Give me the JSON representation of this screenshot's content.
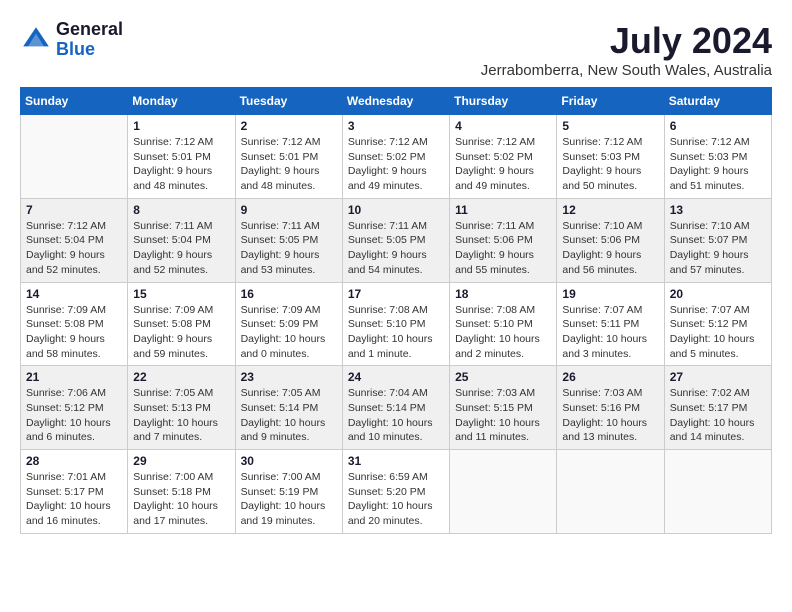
{
  "header": {
    "logo_general": "General",
    "logo_blue": "Blue",
    "title": "July 2024",
    "location": "Jerrabomberra, New South Wales, Australia"
  },
  "weekdays": [
    "Sunday",
    "Monday",
    "Tuesday",
    "Wednesday",
    "Thursday",
    "Friday",
    "Saturday"
  ],
  "weeks": [
    [
      {
        "day": "",
        "info": ""
      },
      {
        "day": "1",
        "info": "Sunrise: 7:12 AM\nSunset: 5:01 PM\nDaylight: 9 hours\nand 48 minutes."
      },
      {
        "day": "2",
        "info": "Sunrise: 7:12 AM\nSunset: 5:01 PM\nDaylight: 9 hours\nand 48 minutes."
      },
      {
        "day": "3",
        "info": "Sunrise: 7:12 AM\nSunset: 5:02 PM\nDaylight: 9 hours\nand 49 minutes."
      },
      {
        "day": "4",
        "info": "Sunrise: 7:12 AM\nSunset: 5:02 PM\nDaylight: 9 hours\nand 49 minutes."
      },
      {
        "day": "5",
        "info": "Sunrise: 7:12 AM\nSunset: 5:03 PM\nDaylight: 9 hours\nand 50 minutes."
      },
      {
        "day": "6",
        "info": "Sunrise: 7:12 AM\nSunset: 5:03 PM\nDaylight: 9 hours\nand 51 minutes."
      }
    ],
    [
      {
        "day": "7",
        "info": "Sunrise: 7:12 AM\nSunset: 5:04 PM\nDaylight: 9 hours\nand 52 minutes."
      },
      {
        "day": "8",
        "info": "Sunrise: 7:11 AM\nSunset: 5:04 PM\nDaylight: 9 hours\nand 52 minutes."
      },
      {
        "day": "9",
        "info": "Sunrise: 7:11 AM\nSunset: 5:05 PM\nDaylight: 9 hours\nand 53 minutes."
      },
      {
        "day": "10",
        "info": "Sunrise: 7:11 AM\nSunset: 5:05 PM\nDaylight: 9 hours\nand 54 minutes."
      },
      {
        "day": "11",
        "info": "Sunrise: 7:11 AM\nSunset: 5:06 PM\nDaylight: 9 hours\nand 55 minutes."
      },
      {
        "day": "12",
        "info": "Sunrise: 7:10 AM\nSunset: 5:06 PM\nDaylight: 9 hours\nand 56 minutes."
      },
      {
        "day": "13",
        "info": "Sunrise: 7:10 AM\nSunset: 5:07 PM\nDaylight: 9 hours\nand 57 minutes."
      }
    ],
    [
      {
        "day": "14",
        "info": "Sunrise: 7:09 AM\nSunset: 5:08 PM\nDaylight: 9 hours\nand 58 minutes."
      },
      {
        "day": "15",
        "info": "Sunrise: 7:09 AM\nSunset: 5:08 PM\nDaylight: 9 hours\nand 59 minutes."
      },
      {
        "day": "16",
        "info": "Sunrise: 7:09 AM\nSunset: 5:09 PM\nDaylight: 10 hours\nand 0 minutes."
      },
      {
        "day": "17",
        "info": "Sunrise: 7:08 AM\nSunset: 5:10 PM\nDaylight: 10 hours\nand 1 minute."
      },
      {
        "day": "18",
        "info": "Sunrise: 7:08 AM\nSunset: 5:10 PM\nDaylight: 10 hours\nand 2 minutes."
      },
      {
        "day": "19",
        "info": "Sunrise: 7:07 AM\nSunset: 5:11 PM\nDaylight: 10 hours\nand 3 minutes."
      },
      {
        "day": "20",
        "info": "Sunrise: 7:07 AM\nSunset: 5:12 PM\nDaylight: 10 hours\nand 5 minutes."
      }
    ],
    [
      {
        "day": "21",
        "info": "Sunrise: 7:06 AM\nSunset: 5:12 PM\nDaylight: 10 hours\nand 6 minutes."
      },
      {
        "day": "22",
        "info": "Sunrise: 7:05 AM\nSunset: 5:13 PM\nDaylight: 10 hours\nand 7 minutes."
      },
      {
        "day": "23",
        "info": "Sunrise: 7:05 AM\nSunset: 5:14 PM\nDaylight: 10 hours\nand 9 minutes."
      },
      {
        "day": "24",
        "info": "Sunrise: 7:04 AM\nSunset: 5:14 PM\nDaylight: 10 hours\nand 10 minutes."
      },
      {
        "day": "25",
        "info": "Sunrise: 7:03 AM\nSunset: 5:15 PM\nDaylight: 10 hours\nand 11 minutes."
      },
      {
        "day": "26",
        "info": "Sunrise: 7:03 AM\nSunset: 5:16 PM\nDaylight: 10 hours\nand 13 minutes."
      },
      {
        "day": "27",
        "info": "Sunrise: 7:02 AM\nSunset: 5:17 PM\nDaylight: 10 hours\nand 14 minutes."
      }
    ],
    [
      {
        "day": "28",
        "info": "Sunrise: 7:01 AM\nSunset: 5:17 PM\nDaylight: 10 hours\nand 16 minutes."
      },
      {
        "day": "29",
        "info": "Sunrise: 7:00 AM\nSunset: 5:18 PM\nDaylight: 10 hours\nand 17 minutes."
      },
      {
        "day": "30",
        "info": "Sunrise: 7:00 AM\nSunset: 5:19 PM\nDaylight: 10 hours\nand 19 minutes."
      },
      {
        "day": "31",
        "info": "Sunrise: 6:59 AM\nSunset: 5:20 PM\nDaylight: 10 hours\nand 20 minutes."
      },
      {
        "day": "",
        "info": ""
      },
      {
        "day": "",
        "info": ""
      },
      {
        "day": "",
        "info": ""
      }
    ]
  ]
}
